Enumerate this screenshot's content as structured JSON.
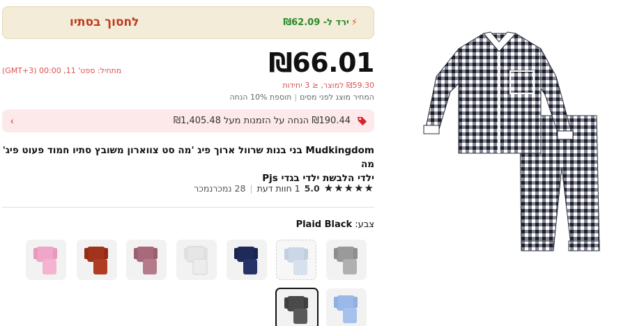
{
  "banner": {
    "cta": "לחסוך בסתיו",
    "deal": "ירד ל- ₪62.09"
  },
  "price": {
    "main": "₪66.01",
    "start_time": "מתחיל: ספט' 11, 00:00 (GMT+3)",
    "unit_price": "₪59.30 למוצר, ≤ 3 יחידות",
    "tax_note": "המחיר מוצג לפני מסים",
    "extra_discount": "תוספת 10% הנחה"
  },
  "discount": {
    "text": "₪190.44 הנחה על הזמנות מעל ₪1,405.48"
  },
  "product": {
    "title_line1": "Mudkingdom בני בנות שרוול ארוך פיג 'מה סט צווארון משובץ סתיו חמוד פעוט פיג' מה",
    "title_line2": "ילדי הלבשת ילדי בגדי Pjs"
  },
  "rating": {
    "stars_display": "★★★★★",
    "score": "5.0",
    "reviews": "1 חוות דעת",
    "sold": "28 נמכרנמכר"
  },
  "color": {
    "label": "צבע:",
    "value": "Plaid Black"
  },
  "swatches": [
    {
      "name": "gray-plaid",
      "color": "#9a9a9a"
    },
    {
      "name": "light-blue-selected-dashed",
      "color": "#cbd7e6"
    },
    {
      "name": "navy",
      "color": "#1e2a5a"
    },
    {
      "name": "white",
      "color": "#f0f0f0"
    },
    {
      "name": "mauve-plaid",
      "color": "#a86a7a"
    },
    {
      "name": "rust",
      "color": "#a3341c"
    },
    {
      "name": "pink",
      "color": "#f0a6c8"
    },
    {
      "name": "light-blue",
      "color": "#9ab8e8"
    },
    {
      "name": "plaid-black",
      "color": "#4a4a4a"
    }
  ],
  "colors": {
    "accent_red": "#c0391e",
    "deal_green": "#2b8a2b",
    "banner_bg": "#f3ecd8",
    "discount_bg": "#fde9ea"
  }
}
